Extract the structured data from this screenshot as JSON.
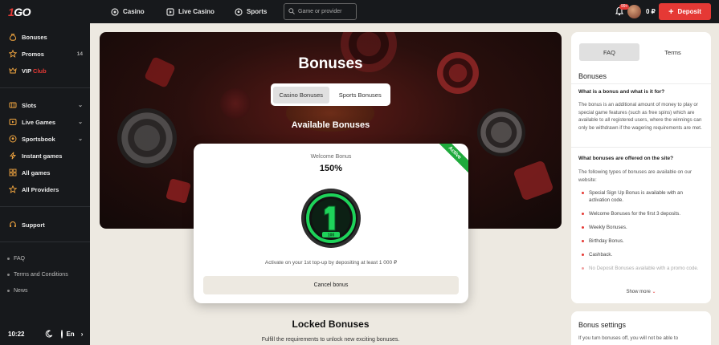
{
  "header": {
    "logo_one": "1",
    "logo_go": "GO",
    "nav": [
      {
        "label": "Casino",
        "icon": "casino-chip-icon"
      },
      {
        "label": "Live Casino",
        "icon": "live-casino-icon"
      },
      {
        "label": "Sports",
        "icon": "soccer-ball-icon"
      }
    ],
    "search_placeholder": "Game or provider",
    "notifications_badge": "99+",
    "balance": "0 ₽",
    "deposit_label": "Deposit"
  },
  "sidebar": {
    "items": [
      {
        "label": "Bonuses",
        "icon": "moneybag-icon"
      },
      {
        "label": "Promos",
        "icon": "star-icon",
        "count": "14"
      },
      {
        "label": "VIP",
        "label_accent": "Club",
        "icon": "crown-icon"
      },
      {
        "label": "Slots",
        "icon": "slots-icon"
      },
      {
        "label": "Live Games",
        "icon": "live-games-icon"
      },
      {
        "label": "Sportsbook",
        "icon": "sportsbook-icon"
      },
      {
        "label": "Instant games",
        "icon": "lightning-icon"
      },
      {
        "label": "All games",
        "icon": "grid-icon"
      },
      {
        "label": "All Providers",
        "icon": "star-outline-icon"
      },
      {
        "label": "Support",
        "icon": "headset-icon"
      }
    ],
    "links": [
      "FAQ",
      "Terms and Conditions",
      "News"
    ],
    "time": "10:22",
    "language": "En"
  },
  "hero": {
    "title": "Bonuses",
    "tabs": [
      {
        "label": "Casino Bonuses",
        "active": true
      },
      {
        "label": "Sports Bonuses",
        "active": false
      }
    ],
    "available_title": "Available Bonuses"
  },
  "bonus_card": {
    "ribbon": "Active",
    "label": "Welcome Bonus",
    "percent": "150%",
    "medal_text": "100",
    "description": "Activate on your 1st top-up by depositing at least 1 000 ₽",
    "cancel_label": "Cancel bonus"
  },
  "locked": {
    "title": "Locked Bonuses",
    "subtitle": "Fulfill the requirements to unlock new exciting bonuses."
  },
  "faq_panel": {
    "tabs": [
      {
        "label": "FAQ",
        "active": true
      },
      {
        "label": "Terms",
        "active": false
      }
    ],
    "heading": "Bonuses",
    "q1": "What is a bonus and what is it for?",
    "a1": "The bonus is an additional amount of money to play or special game features (such as free spins) which are available to all registered users, where the winnings can only be withdrawn if the wagering requirements are met.",
    "q2": "What bonuses are offered on the site?",
    "a2": "The following types of bonuses are available on our website:",
    "list": [
      "Special Sign Up Bonus is available with an activation code.",
      "Welcome Bonuses for the first 3 deposits.",
      "Weekly Bonuses.",
      "Birthday Bonus.",
      "Cashback.",
      "No Deposit Bonuses available with a promo code."
    ],
    "show_more": "Show more"
  },
  "settings_panel": {
    "heading": "Bonus settings",
    "text": "If you turn bonuses off, you will not be able to"
  },
  "colors": {
    "accent_red": "#e53935",
    "active_green": "#1faa3c",
    "sidebar_bg": "#17191c",
    "page_bg": "#ede9e1"
  }
}
